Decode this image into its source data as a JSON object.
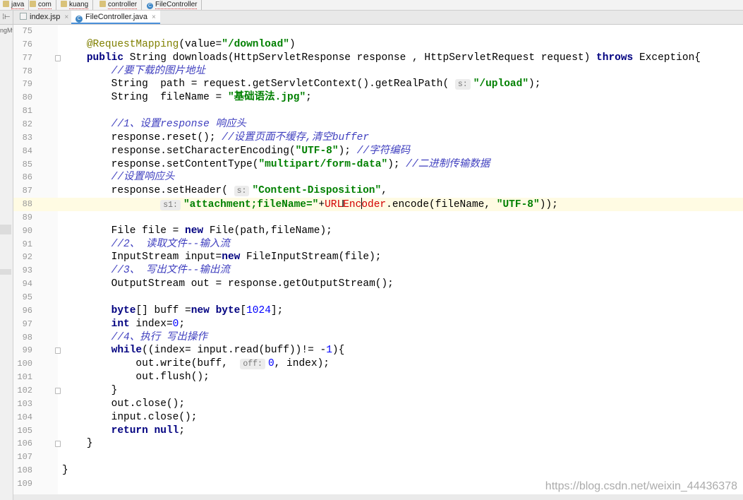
{
  "breadcrumb": [
    "java",
    "com",
    "kuang",
    "controller",
    "FileController"
  ],
  "tabs": [
    {
      "label": "index.jsp",
      "icon": "jsp-file-icon",
      "active": false
    },
    {
      "label": "FileController.java",
      "icon": "java-class-icon",
      "active": true
    }
  ],
  "side_panel_text": "ngMvc",
  "code": {
    "current_line": 88,
    "lines": [
      {
        "n": "75",
        "html": ""
      },
      {
        "n": "76",
        "html": "    <span class='a'>@RequestMapping</span>(value=<span class='s'>\"/download\"</span>)"
      },
      {
        "n": "77",
        "html": "    <span class='k'>public</span> String downloads(HttpServletResponse response , HttpServletRequest request) <span class='k'>throws</span> Exception{",
        "fold": true
      },
      {
        "n": "78",
        "html": "        <span class='c'>//要下载的图片地址</span>"
      },
      {
        "n": "79",
        "html": "        String  path = request.getServletContext().getRealPath( <span class='hint'>s:</span><span class='s'>\"/upload\"</span>);"
      },
      {
        "n": "80",
        "html": "        String  fileName = <span class='s'>\"基础语法.jpg\"</span>;"
      },
      {
        "n": "81",
        "html": ""
      },
      {
        "n": "82",
        "html": "        <span class='c'>//1、设置response 响应头</span>"
      },
      {
        "n": "83",
        "html": "        response.reset(); <span class='c'>//设置页面不缓存,清空buffer</span>"
      },
      {
        "n": "84",
        "html": "        response.setCharacterEncoding(<span class='s'>\"UTF-8\"</span>); <span class='c'>//字符编码</span>"
      },
      {
        "n": "85",
        "html": "        response.setContentType(<span class='s'>\"multipart/form-data\"</span>); <span class='c'>//二进制传输数据</span>"
      },
      {
        "n": "86",
        "html": "        <span class='c'>//设置响应头</span>"
      },
      {
        "n": "87",
        "html": "        response.setHeader( <span class='hint'>s:</span><span class='s'>\"Content-Disposition\"</span>,"
      },
      {
        "n": "88",
        "html": "                <span class='hint'>s1:</span><span class='s'>\"attachment;fileName=\"</span>+<span class='r'>URLEnc</span><span class='caret'></span><span class='r'>oder</span>.encode(fileName, <span class='s'>\"UTF-8\"</span>));"
      },
      {
        "n": "89",
        "html": ""
      },
      {
        "n": "90",
        "html": "        File file = <span class='k'>new</span> File(path,fileName);"
      },
      {
        "n": "91",
        "html": "        <span class='c'>//2、 读取文件--输入流</span>"
      },
      {
        "n": "92",
        "html": "        InputStream input=<span class='k'>new</span> FileInputStream(file);"
      },
      {
        "n": "93",
        "html": "        <span class='c'>//3、 写出文件--输出流</span>"
      },
      {
        "n": "94",
        "html": "        OutputStream out = response.getOutputStream();"
      },
      {
        "n": "95",
        "html": ""
      },
      {
        "n": "96",
        "html": "        <span class='k'>byte</span>[] buff =<span class='k'>new</span> <span class='k'>byte</span>[<span class='n'>1024</span>];"
      },
      {
        "n": "97",
        "html": "        <span class='k'>int</span> index=<span class='n'>0</span>;"
      },
      {
        "n": "98",
        "html": "        <span class='c'>//4、执行 写出操作</span>"
      },
      {
        "n": "99",
        "html": "        <span class='k'>while</span>((index= input.read(buff))!= -<span class='n'>1</span>){",
        "fold": true
      },
      {
        "n": "100",
        "html": "            out.write(buff,  <span class='hint'>off:</span><span class='n'>0</span>, index);"
      },
      {
        "n": "101",
        "html": "            out.flush();"
      },
      {
        "n": "102",
        "html": "        }",
        "fold": true
      },
      {
        "n": "103",
        "html": "        out.close();"
      },
      {
        "n": "104",
        "html": "        input.close();"
      },
      {
        "n": "105",
        "html": "        <span class='k'>return</span> <span class='k'>null</span>;"
      },
      {
        "n": "106",
        "html": "    }",
        "fold": true
      },
      {
        "n": "107",
        "html": ""
      },
      {
        "n": "108",
        "html": "}"
      },
      {
        "n": "109",
        "html": ""
      }
    ]
  },
  "watermark": "https://blog.csdn.net/weixin_44436378"
}
